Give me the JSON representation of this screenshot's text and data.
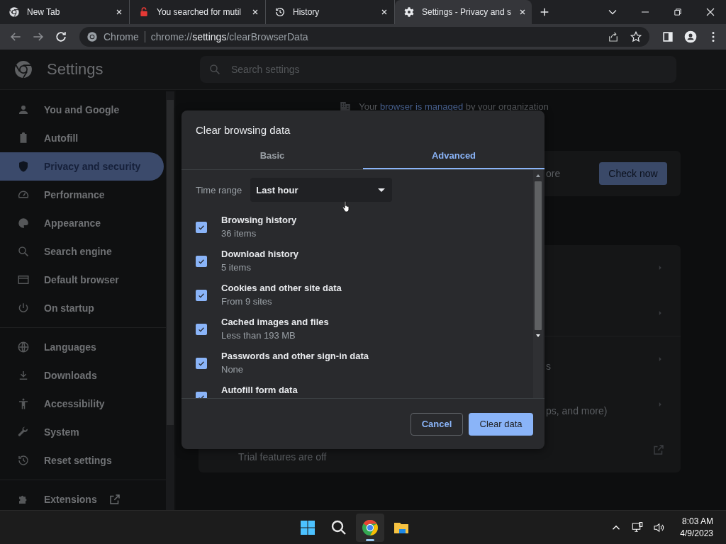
{
  "browser": {
    "tabs": [
      {
        "title": "New Tab",
        "selected": false
      },
      {
        "title": "You searched for mutil",
        "selected": false
      },
      {
        "title": "History",
        "selected": false
      },
      {
        "title": "Settings - Privacy and s",
        "selected": true
      }
    ],
    "address": {
      "site": "Chrome",
      "url": "chrome://**settings**/clearBrowserData"
    }
  },
  "settings": {
    "title": "Settings",
    "search_placeholder": "Search settings",
    "sidebar": {
      "groups": [
        {
          "items": [
            {
              "label": "You and Google",
              "selected": false
            },
            {
              "label": "Autofill",
              "selected": false
            },
            {
              "label": "Privacy and security",
              "selected": true
            },
            {
              "label": "Performance",
              "selected": false
            },
            {
              "label": "Appearance",
              "selected": false
            },
            {
              "label": "Search engine",
              "selected": false
            },
            {
              "label": "Default browser",
              "selected": false
            },
            {
              "label": "On startup",
              "selected": false
            }
          ]
        },
        {
          "items": [
            {
              "label": "Languages",
              "selected": false
            },
            {
              "label": "Downloads",
              "selected": false
            },
            {
              "label": "Accessibility",
              "selected": false
            },
            {
              "label": "System",
              "selected": false
            },
            {
              "label": "Reset settings",
              "selected": false
            }
          ]
        },
        {
          "items": [
            {
              "label": "Extensions",
              "selected": false
            }
          ]
        }
      ]
    },
    "managed": {
      "before": "Your",
      "link": "browser is managed",
      "after": "by your organization"
    },
    "safety_text": "ore",
    "check_button": "Check now",
    "row_texts": [
      "s",
      "ps, and more)"
    ],
    "trial_text": "Trial features are off"
  },
  "dialog": {
    "title": "Clear browsing data",
    "tabs": [
      {
        "label": "Basic",
        "selected": false
      },
      {
        "label": "Advanced",
        "selected": true
      }
    ],
    "time_range": {
      "label": "Time range",
      "value": "Last hour"
    },
    "items": [
      {
        "label": "Browsing history",
        "detail": "36 items",
        "checked": true
      },
      {
        "label": "Download history",
        "detail": "5 items",
        "checked": true
      },
      {
        "label": "Cookies and other site data",
        "detail": "From 9 sites",
        "checked": true
      },
      {
        "label": "Cached images and files",
        "detail": "Less than 193 MB",
        "checked": true
      },
      {
        "label": "Passwords and other sign-in data",
        "detail": "None",
        "checked": true
      },
      {
        "label": "Autofill form data",
        "checked": true
      }
    ],
    "buttons": [
      {
        "label": "Cancel",
        "kind": "secondary"
      },
      {
        "label": "Clear data",
        "kind": "primary"
      }
    ]
  },
  "taskbar": {
    "apps": [
      {
        "active": false
      },
      {
        "active": false
      },
      {
        "active": true
      },
      {
        "active": false
      }
    ],
    "time": "8:03 AM",
    "date": "4/9/2023"
  }
}
